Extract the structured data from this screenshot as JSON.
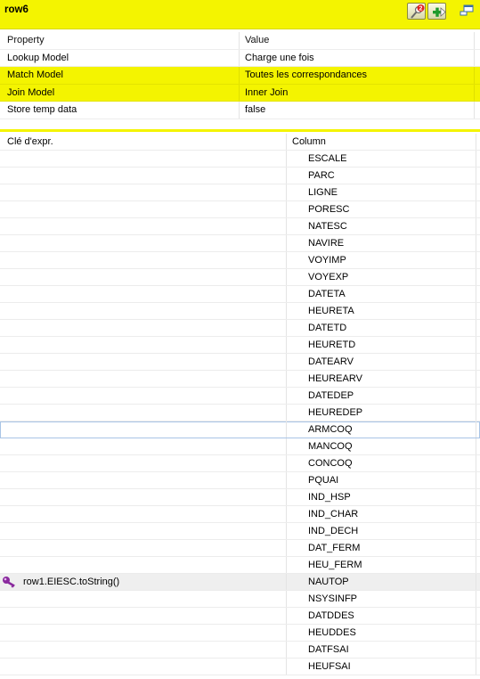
{
  "header": {
    "title": "row6",
    "search_badge": "2"
  },
  "properties": {
    "columns": [
      "Property",
      "Value"
    ],
    "rows": [
      {
        "property": "Lookup Model",
        "value": "Charge une fois"
      },
      {
        "property": "Match Model",
        "value": "Toutes les correspondances"
      },
      {
        "property": "Join Model",
        "value": "Inner Join"
      },
      {
        "property": "Store temp data",
        "value": "false"
      }
    ]
  },
  "mapping": {
    "columns": [
      "Clé d'expr.",
      "Column"
    ],
    "rows": [
      {
        "expr": "",
        "column": "ESCALE"
      },
      {
        "expr": "",
        "column": "PARC"
      },
      {
        "expr": "",
        "column": "LIGNE"
      },
      {
        "expr": "",
        "column": "PORESC"
      },
      {
        "expr": "",
        "column": "NATESC"
      },
      {
        "expr": "",
        "column": "NAVIRE"
      },
      {
        "expr": "",
        "column": "VOYIMP"
      },
      {
        "expr": "",
        "column": "VOYEXP"
      },
      {
        "expr": "",
        "column": "DATETA"
      },
      {
        "expr": "",
        "column": "HEURETA"
      },
      {
        "expr": "",
        "column": "DATETD"
      },
      {
        "expr": "",
        "column": "HEURETD"
      },
      {
        "expr": "",
        "column": "DATEARV"
      },
      {
        "expr": "",
        "column": "HEUREARV"
      },
      {
        "expr": "",
        "column": "DATEDEP"
      },
      {
        "expr": "",
        "column": "HEUREDEP"
      },
      {
        "expr": "",
        "column": "ARMCOQ"
      },
      {
        "expr": "",
        "column": "MANCOQ"
      },
      {
        "expr": "",
        "column": "CONCOQ"
      },
      {
        "expr": "",
        "column": "PQUAI"
      },
      {
        "expr": "",
        "column": "IND_HSP"
      },
      {
        "expr": "",
        "column": "IND_CHAR"
      },
      {
        "expr": "",
        "column": "IND_DECH"
      },
      {
        "expr": "",
        "column": "DAT_FERM"
      },
      {
        "expr": "",
        "column": "HEU_FERM"
      },
      {
        "expr": "row1.EIESC.toString()",
        "column": "NAUTOP"
      },
      {
        "expr": "",
        "column": "NSYSINFP"
      },
      {
        "expr": "",
        "column": "DATDDES"
      },
      {
        "expr": "",
        "column": "HEUDDES"
      },
      {
        "expr": "",
        "column": "DATFSAI"
      },
      {
        "expr": "",
        "column": "HEUFSAI"
      }
    ]
  },
  "colors": {
    "highlight": "#f4f400",
    "selection_border": "#a9c4e6",
    "key_icon": "#8a2a9e"
  }
}
